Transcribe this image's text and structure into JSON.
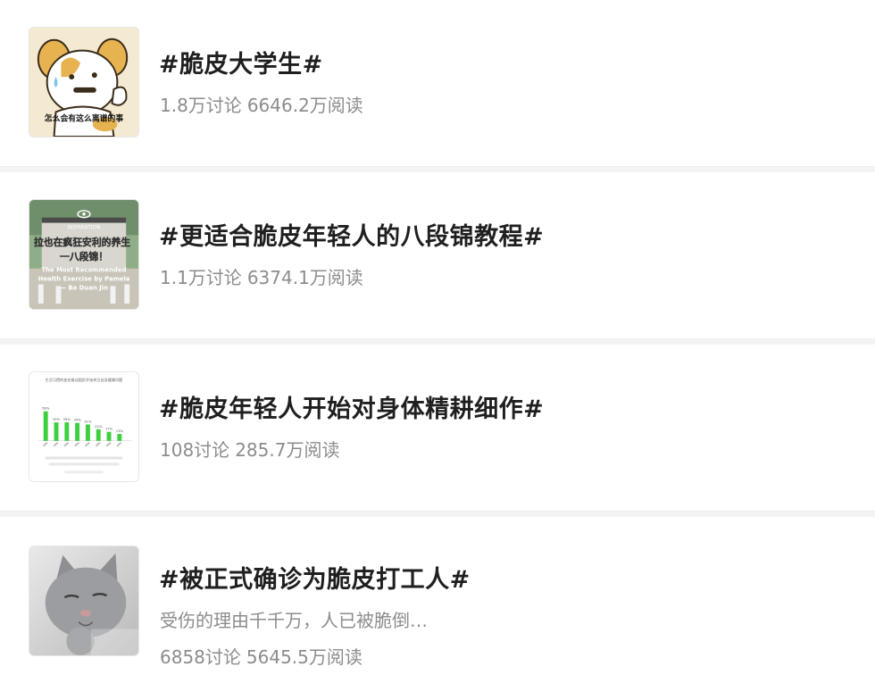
{
  "topics": [
    {
      "title": "#脆皮大学生#",
      "discussions": "1.8万讨论",
      "reads": "6646.2万阅读",
      "thumb_icon": "cartoon-dog-thumbnail",
      "thumb_caption": "怎么会有这么离谱的事"
    },
    {
      "title": "#更适合脆皮年轻人的八段锦教程#",
      "discussions": "1.1万讨论",
      "reads": "6374.1万阅读",
      "thumb_icon": "baduanjin-video-thumbnail",
      "thumb_text": {
        "tag": "INSPIRATION",
        "line1": "拉也在疯狂安利的养生",
        "line2": "一八段锦！",
        "line3": "The Most Recommended",
        "line4": "Health Exercise by Pamela",
        "line5": "— Ba Duan Jin"
      }
    },
    {
      "title": "#脆皮年轻人开始对身体精耕细作#",
      "discussions": "108讨论",
      "reads": "285.7万阅读",
      "thumb_icon": "bar-chart-thumbnail",
      "thumb_chart": {
        "heading": "生活习惯的变化推动国民开始关注自身健康问题",
        "values": [
          "56%",
          "35%",
          "35%",
          "34%",
          "31%",
          "22%",
          "17%",
          "13%"
        ],
        "bar_fraction": [
          0.56,
          0.35,
          0.35,
          0.34,
          0.31,
          0.22,
          0.17,
          0.13
        ],
        "bar_color": "#3ecf3e"
      }
    },
    {
      "title": "#被正式确诊为脆皮打工人#",
      "description": "受伤的理由千千万，人已被脆倒…",
      "discussions": "6858讨论",
      "reads": "5645.5万阅读",
      "thumb_icon": "gray-cat-photo-thumbnail"
    }
  ],
  "colors": {
    "title": "#1f1f1f",
    "meta": "#8c8c8c",
    "separator": "#f3f3f3"
  }
}
